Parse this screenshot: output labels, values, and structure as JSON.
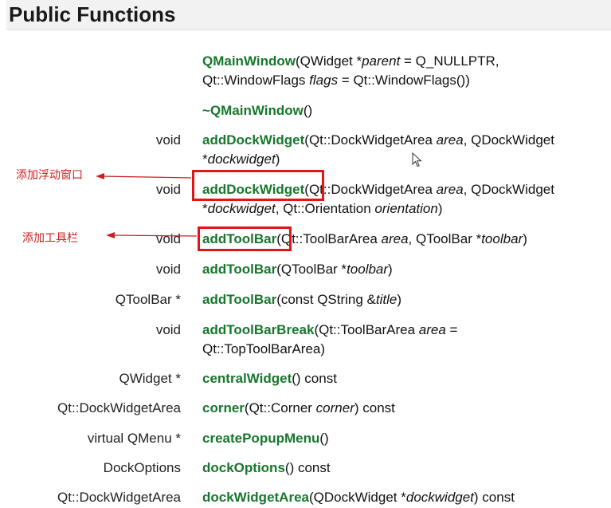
{
  "section_title": "Public Functions",
  "annotations": {
    "dock": "添加浮动窗口",
    "toolbar": "添加工具栏"
  },
  "colors": {
    "function_name": "#17772d",
    "annotation": "#cc1f1f",
    "header_bg": "#f2f2f2"
  },
  "rows": [
    {
      "ret": "",
      "name": "QMainWindow",
      "p1": "(QWidget *",
      "i1": "parent",
      "p2": " = Q_NULLPTR,",
      "p3": "Qt::WindowFlags ",
      "i2": "flags",
      "p4": " = Qt::WindowFlags())"
    },
    {
      "ret": "",
      "name": "~QMainWindow",
      "p1": "()"
    },
    {
      "ret": "void",
      "name": "addDockWidget",
      "p1": "(Qt::DockWidgetArea ",
      "i1": "area",
      "p2": ", QDockWidget",
      "p3": "*",
      "i2": "dockwidget",
      "p4": ")"
    },
    {
      "ret": "void",
      "name": "addDockWidget",
      "p1": "(Qt::DockWidgetArea ",
      "i1": "area",
      "p2": ", QDockWidget",
      "p3": "*",
      "i2": "dockwidget",
      "p4": ", Qt::Orientation ",
      "i3": "orientation",
      "p5": ")"
    },
    {
      "ret": "void",
      "name": "addToolBar",
      "p1": "(Qt::ToolBarArea ",
      "i1": "area",
      "p2": ", QToolBar *",
      "i2": "toolbar",
      "p3": ")"
    },
    {
      "ret": "void",
      "name": "addToolBar",
      "p1": "(QToolBar *",
      "i1": "toolbar",
      "p2": ")"
    },
    {
      "ret": "QToolBar *",
      "name": "addToolBar",
      "p1": "(const QString &",
      "i1": "title",
      "p2": ")"
    },
    {
      "ret": "void",
      "name": "addToolBarBreak",
      "p1": "(Qt::ToolBarArea ",
      "i1": "area",
      "p2": " =",
      "p3": "Qt::TopToolBarArea)"
    },
    {
      "ret": "QWidget *",
      "name": "centralWidget",
      "p1": "() const"
    },
    {
      "ret": "Qt::DockWidgetArea",
      "name": "corner",
      "p1": "(Qt::Corner ",
      "i1": "corner",
      "p2": ") const"
    },
    {
      "ret": "virtual QMenu *",
      "name": "createPopupMenu",
      "p1": "()"
    },
    {
      "ret": "DockOptions",
      "name": "dockOptions",
      "p1": "() const"
    },
    {
      "ret": "Qt::DockWidgetArea",
      "name": "dockWidgetArea",
      "p1": "(QDockWidget *",
      "i1": "dockwidget",
      "p2": ") const"
    }
  ]
}
